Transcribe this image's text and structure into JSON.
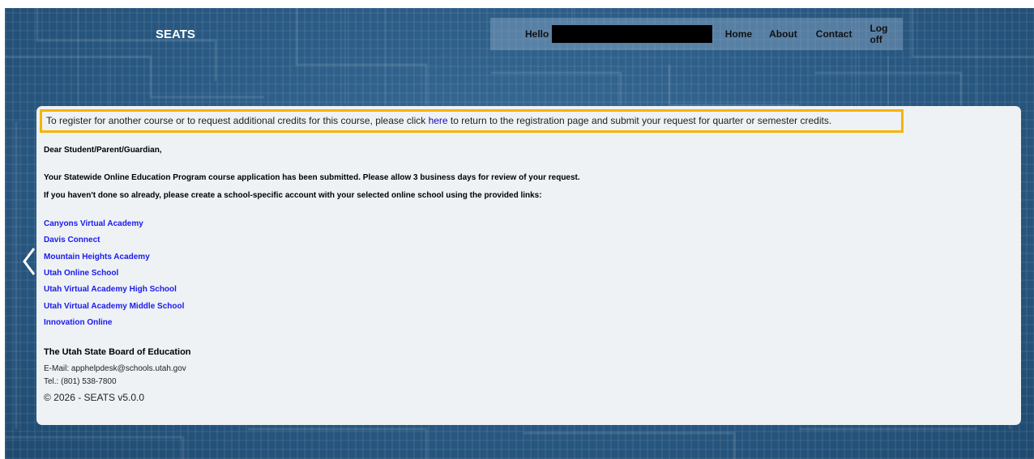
{
  "header": {
    "brand": "SEATS",
    "greeting": "Hello",
    "nav": {
      "home": "Home",
      "about": "About",
      "contact": "Contact",
      "logoff": "Log off"
    }
  },
  "notice": {
    "before": "To register for another course or to request additional credits for this course, please click ",
    "link": "here",
    "after": " to return to the registration page and submit your request for quarter or semester credits."
  },
  "message": {
    "salutation": "Dear Student/Parent/Guardian,",
    "line1": "Your Statewide Online Education Program course application has been submitted. Please allow 3 business days for review of your request.",
    "line2": "If you haven't done so already, please create a school-specific account with your selected online school using the provided links:"
  },
  "schools": [
    "Canyons Virtual Academy",
    "Davis Connect",
    "Mountain Heights Academy",
    "Utah Online School",
    "Utah Virtual Academy High School",
    "Utah Virtual Academy Middle School",
    "Innovation Online"
  ],
  "footer": {
    "org": "The Utah State Board of Education",
    "email": "E-Mail: apphelpdesk@schools.utah.gov",
    "tel": "Tel.: (801) 538-7800",
    "copyright": "© 2026 - SEATS v5.0.0"
  },
  "icons": {
    "prev": "chevron-left-icon",
    "next": "chevron-right-icon"
  },
  "colors": {
    "background": "#2b5d87",
    "notice_border": "#f5b400",
    "link": "#1a1aee"
  }
}
